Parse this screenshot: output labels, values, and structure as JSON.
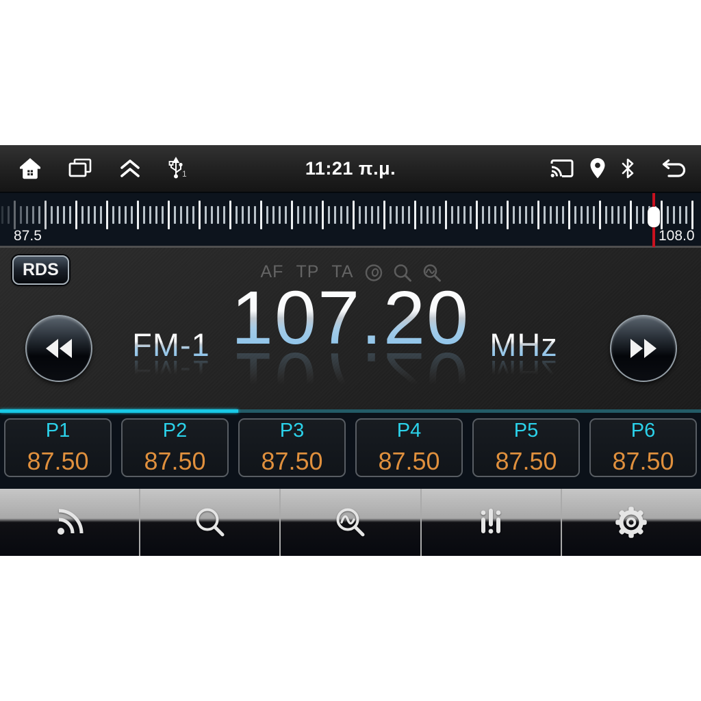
{
  "status_bar": {
    "clock": "11:21 π.μ.",
    "usb_badge": "1",
    "left_icons": [
      "home-icon",
      "recents-icon",
      "chevrons-up-icon",
      "usb-icon"
    ],
    "right_icons": [
      "cast-icon",
      "location-icon",
      "bluetooth-icon",
      "back-icon"
    ]
  },
  "tuner_scale": {
    "min_label": "87.5",
    "max_label": "108.0"
  },
  "rds_button": {
    "label": "RDS"
  },
  "indicators": {
    "af": "AF",
    "tp": "TP",
    "ta": "TA",
    "icons": [
      "pty-circle-icon",
      "search-icon",
      "scan-icon"
    ]
  },
  "tuner": {
    "band": "FM-1",
    "frequency": "107.20",
    "unit": "MHz"
  },
  "band_progress": {
    "percent": 34
  },
  "presets": [
    {
      "label": "P1",
      "value": "87.50"
    },
    {
      "label": "P2",
      "value": "87.50"
    },
    {
      "label": "P3",
      "value": "87.50"
    },
    {
      "label": "P4",
      "value": "87.50"
    },
    {
      "label": "P5",
      "value": "87.50"
    },
    {
      "label": "P6",
      "value": "87.50"
    }
  ],
  "toolbar": {
    "buttons": [
      "broadcast",
      "search",
      "scan",
      "equalizer",
      "settings"
    ]
  },
  "colors": {
    "accent_cyan": "#2bd2ea",
    "preset_value_orange": "#e0903d",
    "needle_red": "#c8111f",
    "progress_bright": "#19c9e6",
    "progress_dim": "#235b67"
  }
}
